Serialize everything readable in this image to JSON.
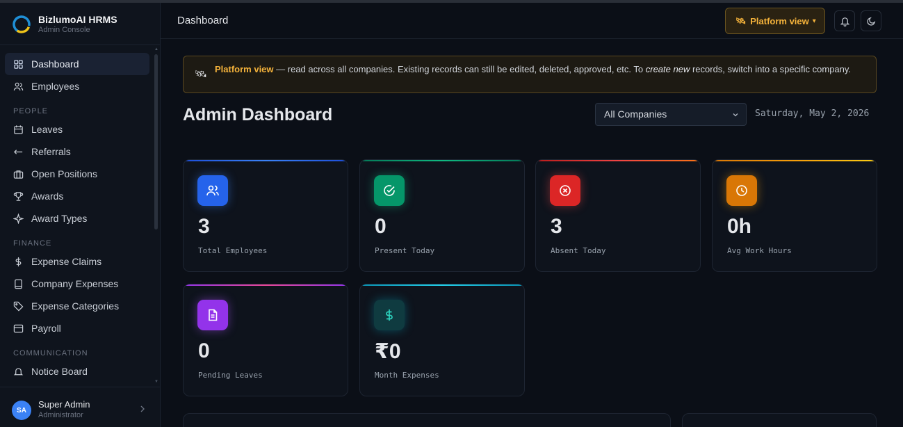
{
  "brand": {
    "title": "BizlumoAI HRMS",
    "subtitle": "Admin Console"
  },
  "sidebar": {
    "top_items": [
      {
        "label": "Dashboard",
        "icon": "grid-icon",
        "active": true
      },
      {
        "label": "Employees",
        "icon": "users-icon"
      }
    ],
    "sections": [
      {
        "title": "PEOPLE",
        "items": [
          {
            "label": "Leaves",
            "icon": "calendar-icon"
          },
          {
            "label": "Referrals",
            "icon": "arrows-icon"
          },
          {
            "label": "Open Positions",
            "icon": "briefcase-icon"
          },
          {
            "label": "Awards",
            "icon": "trophy-icon"
          },
          {
            "label": "Award Types",
            "icon": "sparkle-icon"
          }
        ]
      },
      {
        "title": "FINANCE",
        "items": [
          {
            "label": "Expense Claims",
            "icon": "dollar-icon"
          },
          {
            "label": "Company Expenses",
            "icon": "receipt-icon"
          },
          {
            "label": "Expense Categories",
            "icon": "tag-icon"
          },
          {
            "label": "Payroll",
            "icon": "wallet-icon"
          }
        ]
      },
      {
        "title": "COMMUNICATION",
        "items": [
          {
            "label": "Notice Board",
            "icon": "bell-icon"
          }
        ]
      }
    ]
  },
  "user": {
    "initials": "SA",
    "name": "Super Admin",
    "role": "Administrator"
  },
  "header": {
    "title": "Dashboard",
    "platform_label": "Platform view",
    "platform_caret": "▾"
  },
  "banner": {
    "strong": "Platform view",
    "text1": " — read across all companies. Existing records can still be edited, deleted, approved, etc. To ",
    "em": "create new",
    "text2": " records, switch into a specific company."
  },
  "dashboard": {
    "title": "Admin Dashboard",
    "company_filter": "All Companies",
    "date": "Saturday, May 2, 2026"
  },
  "stats": [
    {
      "value": "3",
      "label": "Total Employees",
      "accent": "#3b82f6",
      "icon": "users-icon"
    },
    {
      "value": "0",
      "label": "Present Today",
      "accent": "#10b981",
      "icon": "check-circle-icon"
    },
    {
      "value": "3",
      "label": "Absent Today",
      "accent": "#ef4444",
      "icon": "x-circle-icon"
    },
    {
      "value": "0h",
      "label": "Avg Work Hours",
      "accent": "#f59e0b",
      "icon": "clock-icon"
    },
    {
      "value": "0",
      "label": "Pending Leaves",
      "accent": "#a855f7",
      "icon": "document-icon"
    },
    {
      "value": "₹0",
      "label": "Month Expenses",
      "accent": "#06b6d4",
      "icon": "dollar-icon"
    }
  ]
}
